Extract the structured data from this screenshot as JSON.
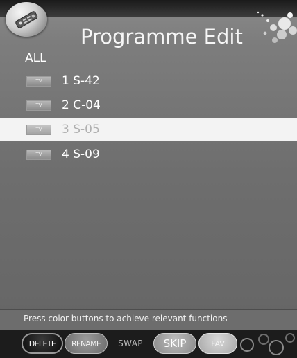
{
  "header": {
    "title": "Programme Edit",
    "app_icon": "remote-control-icon",
    "decoration": "bubbles-decoration"
  },
  "list": {
    "group_label": "ALL",
    "badge_text": "TV",
    "items": [
      {
        "label": "1 S-42",
        "selected": false
      },
      {
        "label": "2 C-04",
        "selected": false
      },
      {
        "label": "3 S-05",
        "selected": true
      },
      {
        "label": "4 S-09",
        "selected": false
      }
    ]
  },
  "footer": {
    "hint": "Press color buttons to achieve relevant functions",
    "buttons": {
      "delete": "DELETE",
      "rename": "RENAME",
      "swap": "SWAP",
      "skip": "SKIP",
      "fav": "FAV"
    }
  },
  "colors": {
    "selected_row_bg": "#f3f3f3",
    "panel_bg": "#6e6e6e",
    "bottom_bar_bg": "#1c1c1c"
  }
}
